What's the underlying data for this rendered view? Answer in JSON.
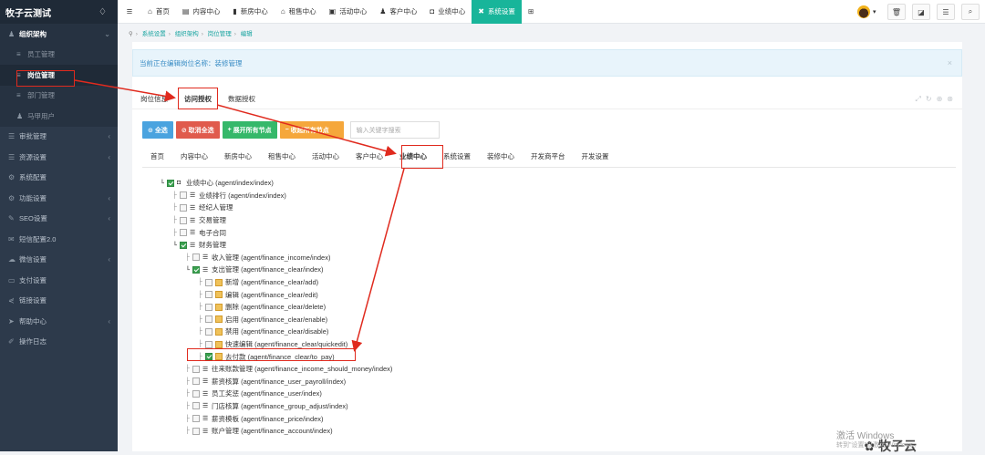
{
  "brand": "牧子云测试",
  "sidebar": {
    "items": [
      {
        "label": "组织架构",
        "icon": "user-icon",
        "state": "open"
      },
      {
        "label": "员工管理",
        "icon": "list-icon",
        "state": "sub"
      },
      {
        "label": "岗位管理",
        "icon": "list-icon",
        "state": "active"
      },
      {
        "label": "部门管理",
        "icon": "list-icon",
        "state": "sub"
      },
      {
        "label": "马甲用户",
        "icon": "user-icon",
        "state": "sub"
      },
      {
        "label": "审批管理",
        "icon": "list-icon"
      },
      {
        "label": "资源设置",
        "icon": "list-icon"
      },
      {
        "label": "系统配置",
        "icon": "gear-icon"
      },
      {
        "label": "功能设置",
        "icon": "gear-icon"
      },
      {
        "label": "SEO设置",
        "icon": "edit-icon"
      },
      {
        "label": "短信配置2.0",
        "icon": "message-icon"
      },
      {
        "label": "微信设置",
        "icon": "wechat-icon"
      },
      {
        "label": "支付设置",
        "icon": "card-icon"
      },
      {
        "label": "链接设置",
        "icon": "link-icon"
      },
      {
        "label": "帮助中心",
        "icon": "help-icon"
      },
      {
        "label": "操作日志",
        "icon": "log-icon"
      }
    ]
  },
  "topbar": {
    "tabs": [
      {
        "label": "首页",
        "icon": "home-icon"
      },
      {
        "label": "内容中心",
        "icon": "content-icon"
      },
      {
        "label": "新房中心",
        "icon": "building-icon"
      },
      {
        "label": "租售中心",
        "icon": "house-icon"
      },
      {
        "label": "活动中心",
        "icon": "activity-icon"
      },
      {
        "label": "客户中心",
        "icon": "customer-icon"
      },
      {
        "label": "业绩中心",
        "icon": "performance-icon"
      },
      {
        "label": "系统设置",
        "icon": "settings-icon"
      }
    ]
  },
  "breadcrumb": [
    "系统设置",
    "组织架构",
    "岗位管理",
    "编辑"
  ],
  "notice": "当前正在编辑岗位名称：装修管理",
  "panel_tabs": [
    "岗位信息",
    "访问授权",
    "数据授权"
  ],
  "buttons": {
    "select_all": "全选",
    "cancel_all": "取消全选",
    "expand_all": "展开所有节点",
    "collapse_all": "收起所有节点",
    "search_placeholder": "输入关键字搜索"
  },
  "module_tabs": [
    "首页",
    "内容中心",
    "新房中心",
    "租售中心",
    "活动中心",
    "客户中心",
    "业绩中心",
    "系统设置",
    "装修中心",
    "开发商平台",
    "开发设置"
  ],
  "tree": [
    {
      "label": "业绩中心 (agent/index/index)",
      "level": 0,
      "checked": true
    },
    {
      "label": "业绩排行 (agent/index/index)",
      "level": 1,
      "checked": false
    },
    {
      "label": "经纪人管理",
      "level": 1,
      "checked": false
    },
    {
      "label": "交易管理",
      "level": 1,
      "checked": false
    },
    {
      "label": "电子合同",
      "level": 1,
      "checked": false
    },
    {
      "label": "财务管理",
      "level": 1,
      "checked": true
    },
    {
      "label": "收入管理 (agent/finance_income/index)",
      "level": 2,
      "checked": false
    },
    {
      "label": "支出管理 (agent/finance_clear/index)",
      "level": 2,
      "checked": true
    },
    {
      "label": "新增 (agent/finance_clear/add)",
      "level": 3,
      "checked": false
    },
    {
      "label": "编辑 (agent/finance_clear/edit)",
      "level": 3,
      "checked": false
    },
    {
      "label": "删除 (agent/finance_clear/delete)",
      "level": 3,
      "checked": false
    },
    {
      "label": "启用 (agent/finance_clear/enable)",
      "level": 3,
      "checked": false
    },
    {
      "label": "禁用 (agent/finance_clear/disable)",
      "level": 3,
      "checked": false
    },
    {
      "label": "快速编辑 (agent/finance_clear/quickedit)",
      "level": 3,
      "checked": false
    },
    {
      "label": "去付款 (agent/finance_clear/to_pay)",
      "level": 3,
      "checked": true
    },
    {
      "label": "往来账款管理 (agent/finance_income_should_money/index)",
      "level": 2,
      "checked": false
    },
    {
      "label": "薪资核算 (agent/finance_user_payroll/index)",
      "level": 2,
      "checked": false
    },
    {
      "label": "员工奖惩 (agent/finance_user/index)",
      "level": 2,
      "checked": false
    },
    {
      "label": "门店核算 (agent/finance_group_adjust/index)",
      "level": 2,
      "checked": false
    },
    {
      "label": "薪资模板 (agent/finance_price/index)",
      "level": 2,
      "checked": false
    },
    {
      "label": "账户管理 (agent/finance_account/index)",
      "level": 2,
      "checked": false
    }
  ],
  "watermark": "牧子云",
  "windows": {
    "line1": "激活 Windows",
    "line2": "转到\"设置\"以激活 Windows。"
  },
  "colors": {
    "accent": "#18b59a",
    "sidebar": "#2d3a4b",
    "highlight": "#e02a1e"
  }
}
